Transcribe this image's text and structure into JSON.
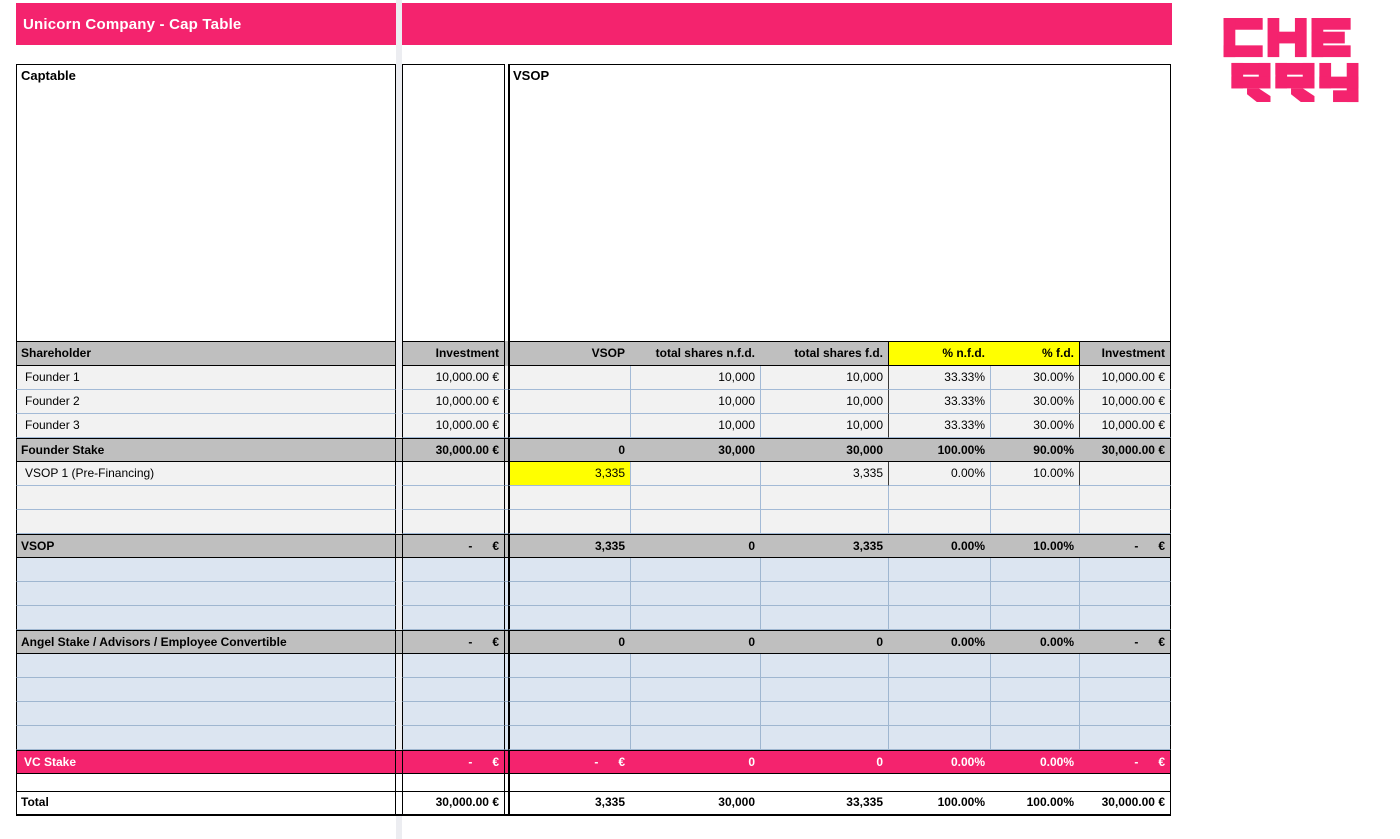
{
  "title_bar": {
    "title": "Unicorn Company - Cap Table"
  },
  "logo": {
    "text": "CHERRY",
    "line1": "CHE",
    "line2": "RRY"
  },
  "colors": {
    "accent_pink": "#F4236E",
    "header_gray": "#BFBFBF",
    "row_light": "#F2F2F2",
    "row_blue": "#DCE5F1",
    "highlight_yellow": "#FFFF00"
  },
  "sections": {
    "left_header": "Captable",
    "right_header": "VSOP"
  },
  "table": {
    "columns": [
      {
        "key": "name",
        "label": "Shareholder"
      },
      {
        "key": "investment",
        "label": "Investment"
      },
      {
        "key": "vsop",
        "label": "VSOP"
      },
      {
        "key": "shares_nfd",
        "label": "total shares n.f.d."
      },
      {
        "key": "shares_fd",
        "label": "total shares f.d."
      },
      {
        "key": "pct_nfd",
        "label": "% n.f.d.",
        "yellow": true
      },
      {
        "key": "pct_fd",
        "label": "% f.d.",
        "yellow": true
      },
      {
        "key": "investment2",
        "label": "Investment"
      }
    ],
    "rows": [
      {
        "type": "data",
        "name": "Founder 1",
        "investment": "10,000.00 €",
        "vsop": "",
        "shares_nfd": "10,000",
        "shares_fd": "10,000",
        "pct_nfd": "33.33%",
        "pct_fd": "30.00%",
        "investment2": "10,000.00 €"
      },
      {
        "type": "data",
        "name": "Founder 2",
        "investment": "10,000.00 €",
        "vsop": "",
        "shares_nfd": "10,000",
        "shares_fd": "10,000",
        "pct_nfd": "33.33%",
        "pct_fd": "30.00%",
        "investment2": "10,000.00 €"
      },
      {
        "type": "data",
        "name": "Founder 3",
        "investment": "10,000.00 €",
        "vsop": "",
        "shares_nfd": "10,000",
        "shares_fd": "10,000",
        "pct_nfd": "33.33%",
        "pct_fd": "30.00%",
        "investment2": "10,000.00 €"
      },
      {
        "type": "subtotal",
        "name": "Founder Stake",
        "investment": "30,000.00 €",
        "vsop": "0",
        "shares_nfd": "30,000",
        "shares_fd": "30,000",
        "pct_nfd": "100.00%",
        "pct_fd": "90.00%",
        "investment2": "30,000.00 €"
      },
      {
        "type": "data",
        "name": "VSOP 1 (Pre-Financing)",
        "investment": "",
        "vsop": "3,335",
        "vsop_highlight": true,
        "shares_nfd": "",
        "shares_fd": "3,335",
        "pct_nfd": "0.00%",
        "pct_fd": "10.00%",
        "investment2": ""
      },
      {
        "type": "empty"
      },
      {
        "type": "empty"
      },
      {
        "type": "subtotal",
        "name": "VSOP",
        "investment": "-      €",
        "vsop": "3,335",
        "shares_nfd": "0",
        "shares_fd": "3,335",
        "pct_nfd": "0.00%",
        "pct_fd": "10.00%",
        "investment2": "-      €"
      },
      {
        "type": "blue"
      },
      {
        "type": "blue"
      },
      {
        "type": "blue"
      },
      {
        "type": "subtotal",
        "name": "Angel Stake / Advisors / Employee Convertible",
        "investment": "-      €",
        "vsop": "0",
        "shares_nfd": "0",
        "shares_fd": "0",
        "pct_nfd": "0.00%",
        "pct_fd": "0.00%",
        "investment2": "-      €"
      },
      {
        "type": "blue"
      },
      {
        "type": "blue"
      },
      {
        "type": "blue"
      },
      {
        "type": "blue"
      },
      {
        "type": "pink",
        "name": "VC Stake",
        "investment": "-      €",
        "vsop": "-      €",
        "shares_nfd": "0",
        "shares_fd": "0",
        "pct_nfd": "0.00%",
        "pct_fd": "0.00%",
        "investment2": "-      €"
      },
      {
        "type": "spacer"
      },
      {
        "type": "total",
        "name": "Total",
        "investment": "30,000.00 €",
        "vsop": "3,335",
        "shares_nfd": "30,000",
        "shares_fd": "33,335",
        "pct_nfd": "100.00%",
        "pct_fd": "100.00%",
        "investment2": "30,000.00 €"
      }
    ]
  }
}
